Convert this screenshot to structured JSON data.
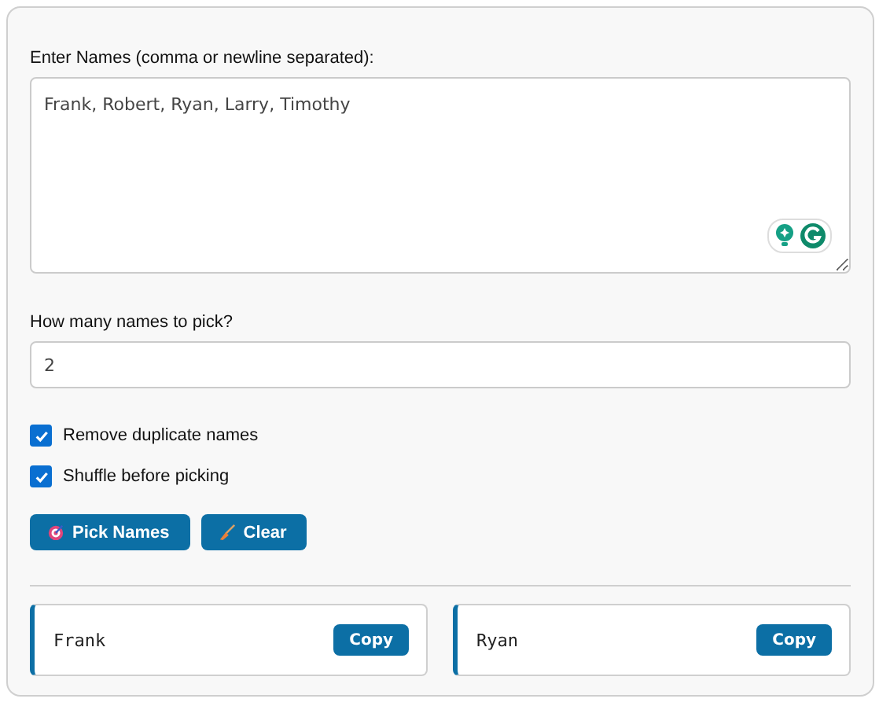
{
  "names_field": {
    "label": "Enter Names (comma or newline separated):",
    "value": "Frank, Robert, Ryan, Larry, Timothy"
  },
  "count_field": {
    "label": "How many names to pick?",
    "value": "2"
  },
  "options": [
    {
      "label": "Remove duplicate names",
      "checked": true
    },
    {
      "label": "Shuffle before picking",
      "checked": true
    }
  ],
  "buttons": [
    {
      "label": "Pick Names",
      "kind": "pick"
    },
    {
      "label": "Clear",
      "kind": "clear"
    }
  ],
  "results": [
    {
      "name": "Frank",
      "action": "Copy"
    },
    {
      "name": "Ryan",
      "action": "Copy"
    }
  ]
}
